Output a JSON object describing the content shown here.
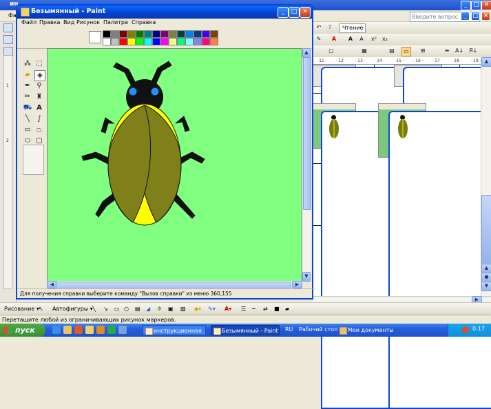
{
  "word": {
    "title_fragment": "ин",
    "menu_fragment": "Фа",
    "ask_placeholder": "Введите вопрос",
    "reading_label": "Чтение",
    "ruler_ticks": [
      "· 11 ·",
      "· 12 ·",
      "· 13 ·",
      "· 14 ·",
      "· 15 ·",
      "· 16 ·",
      "· 17 ·",
      "· 18 ·",
      "· 19 ·"
    ],
    "left_ruler_numbers": [
      "1",
      "2"
    ],
    "drawing_toolbar": {
      "drawing_label": "Рисование ▾",
      "autoshapes_label": "Автофигуры ▾"
    },
    "status_text": "Перетащите любой из ограничивающих рисунок маркеров."
  },
  "paint": {
    "title": "Безымянный - Paint",
    "menu": [
      "Файл",
      "Правка",
      "Вид",
      "Рисунок",
      "Палитра",
      "Справка"
    ],
    "status_text": "Для получения справки выберите команду \"Вызов справки\" из меню 360,155",
    "palette_top": [
      "#000000",
      "#808080",
      "#800000",
      "#808000",
      "#008000",
      "#008080",
      "#000080",
      "#800080",
      "#808040",
      "#004040",
      "#0080ff",
      "#004080",
      "#4000ff",
      "#804000"
    ],
    "palette_bottom": [
      "#ffffff",
      "#c0c0c0",
      "#ff0000",
      "#ffff00",
      "#00ff00",
      "#00ffff",
      "#0000ff",
      "#ff00ff",
      "#ffff80",
      "#00ff80",
      "#80ffff",
      "#8080ff",
      "#ff0080",
      "#ff8040"
    ],
    "canvas_color": "#80ff80",
    "foreground_color": "#80ff80"
  },
  "taskbar": {
    "start_label": "пуск",
    "tasks": [
      "инструкционная ...",
      "Безымянный - Paint"
    ],
    "lang": "RU",
    "desktop_label": "Рабочий стол",
    "docs_label": "Мои документы",
    "clock": "0:17"
  }
}
